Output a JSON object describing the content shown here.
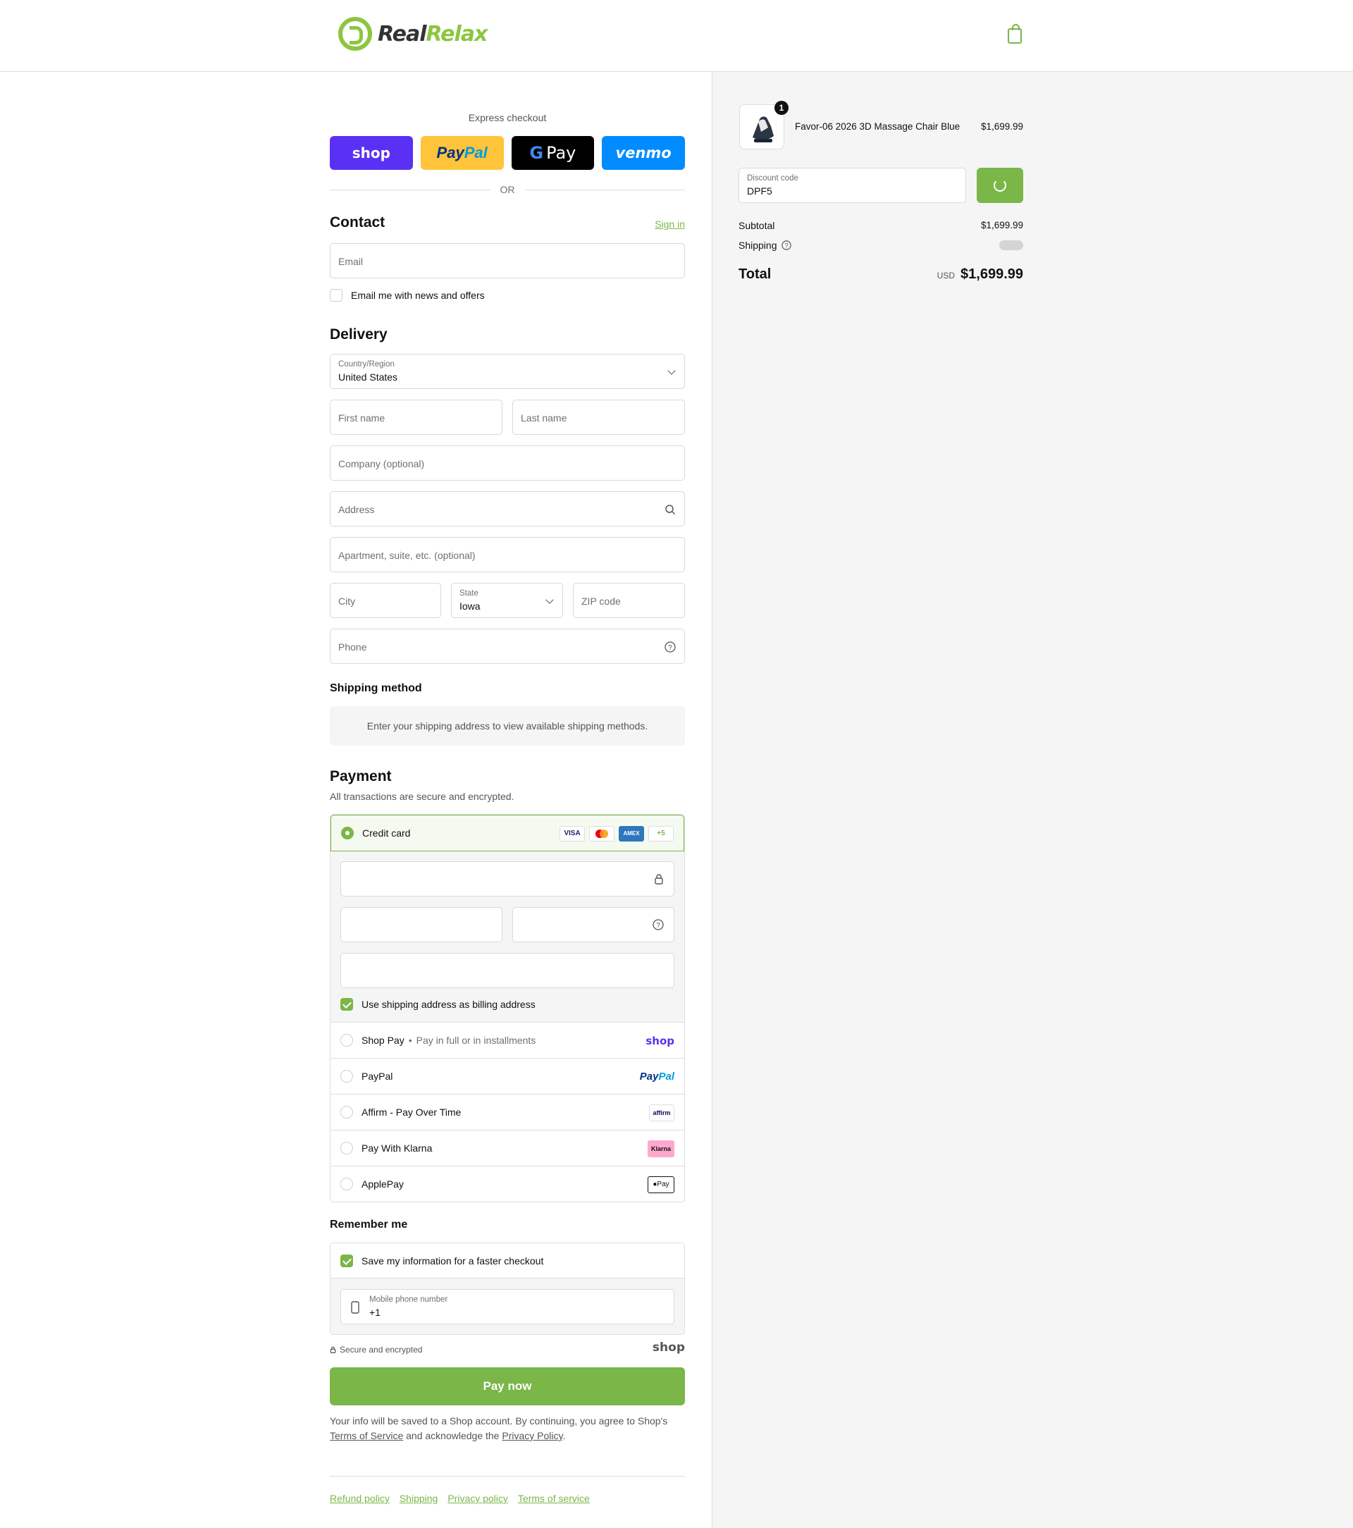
{
  "header": {
    "brand_part1": "Real",
    "brand_part2": "Relax",
    "cart_icon": "shopping-bag-icon"
  },
  "express": {
    "title": "Express checkout",
    "buttons": [
      {
        "label": "shop",
        "color": "#5a31f4"
      },
      {
        "label_a": "Pay",
        "label_b": "Pal",
        "color": "#ffc439"
      },
      {
        "label_g": "G",
        "label": "Pay",
        "color": "#000000"
      },
      {
        "label": "venmo",
        "color": "#008cff"
      }
    ],
    "or": "OR"
  },
  "contact": {
    "title": "Contact",
    "sign_in": "Sign in",
    "email_placeholder": "Email",
    "news_label": "Email me with news and offers"
  },
  "delivery": {
    "title": "Delivery",
    "country_label": "Country/Region",
    "country_value": "United States",
    "first_name": "First name",
    "last_name": "Last name",
    "company": "Company (optional)",
    "address": "Address",
    "apartment": "Apartment, suite, etc. (optional)",
    "city": "City",
    "state_label": "State",
    "state_value": "Iowa",
    "zip": "ZIP code",
    "phone": "Phone"
  },
  "shipping_method": {
    "title": "Shipping method",
    "message": "Enter your shipping address to view available shipping methods."
  },
  "payment": {
    "title": "Payment",
    "subtitle": "All transactions are secure and encrypted.",
    "credit_card": "Credit card",
    "card_logos": [
      "VISA",
      "MC",
      "AMEX",
      "+5"
    ],
    "billing_same": "Use shipping address as billing address",
    "shop_pay": "Shop Pay",
    "shop_pay_desc": "Pay in full or in installments",
    "shop_pay_logo": "shop",
    "paypal": "PayPal",
    "paypal_logo_a": "Pay",
    "paypal_logo_b": "Pal",
    "affirm": "Affirm - Pay Over Time",
    "affirm_logo": "affirm",
    "klarna": "Pay With Klarna",
    "klarna_logo": "Klarna",
    "applepay": "ApplePay",
    "applepay_logo": "Pay"
  },
  "remember": {
    "title": "Remember me",
    "save_label": "Save my information for a faster checkout",
    "mobile_label": "Mobile phone number",
    "mobile_value": "+1",
    "secure": "Secure and encrypted",
    "shop_logo": "shop"
  },
  "pay_now": "Pay now",
  "legal": {
    "text1": "Your info will be saved to a Shop account. By continuing, you agree to Shop's",
    "tos": "Terms of Service",
    "text2": "and acknowledge the",
    "privacy": "Privacy Policy",
    "end": "."
  },
  "footer": [
    "Refund policy",
    "Shipping",
    "Privacy policy",
    "Terms of service"
  ],
  "summary": {
    "product_name": "Favor-06 2026 3D Massage Chair Blue",
    "product_price": "$1,699.99",
    "quantity": "1",
    "discount_label": "Discount code",
    "discount_value": "DPF5",
    "subtotal_label": "Subtotal",
    "subtotal_value": "$1,699.99",
    "shipping_label": "Shipping",
    "total_label": "Total",
    "currency": "USD",
    "total_value": "$1,699.99"
  }
}
